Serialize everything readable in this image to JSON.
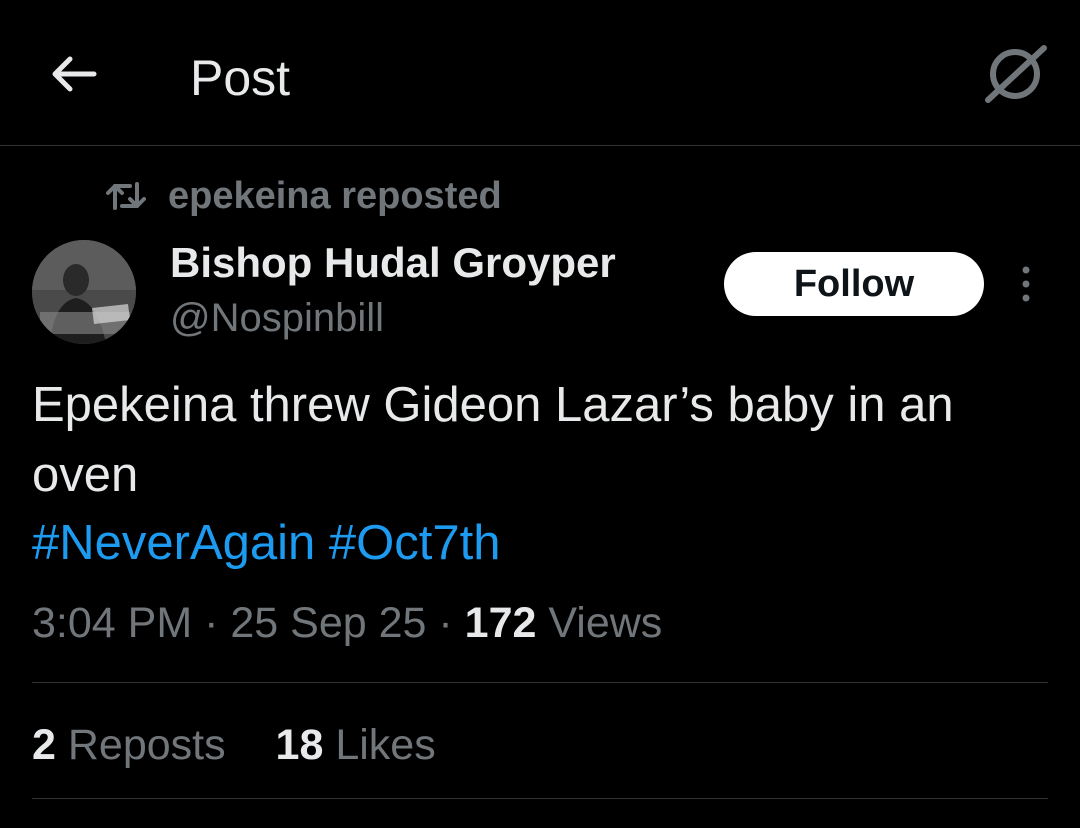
{
  "header": {
    "title": "Post",
    "back_icon": "arrow-left-icon",
    "grok_icon": "grok-icon"
  },
  "post": {
    "repost_label": "epekeina reposted",
    "repost_icon": "repost-icon",
    "author": {
      "name": "Bishop Hudal Groyper",
      "handle": "@Nospinbill"
    },
    "follow_label": "Follow",
    "more_icon": "more-vertical-icon",
    "text": "Epekeina threw Gideon Lazar’s baby in an oven",
    "hashtags": [
      "#NeverAgain",
      "#Oct7th"
    ],
    "time": "3:04 PM",
    "date": "25 Sep 25",
    "separator": "·",
    "views_count": "172",
    "views_label": "Views",
    "reposts_count": "2",
    "reposts_label": "Reposts",
    "likes_count": "18",
    "likes_label": "Likes"
  },
  "colors": {
    "background": "#000000",
    "text": "#e7e9ea",
    "secondary": "#71767b",
    "link": "#1d9bf0",
    "divider": "#2f3336"
  }
}
